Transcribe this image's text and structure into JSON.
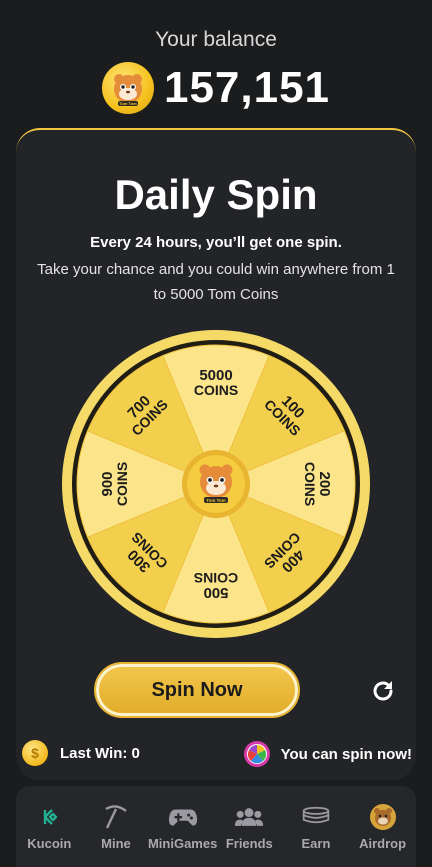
{
  "header": {
    "balance_label": "Your balance",
    "balance_value": "157,151",
    "avatar_caption": "Tom Tom"
  },
  "spin": {
    "title": "Daily Spin",
    "subtitle": "Every 24 hours, you’ll get one spin.",
    "description": "Take your chance and you could win anywhere from 1 to 5000 Tom Coins",
    "center_caption": "Tom Tom",
    "segments": [
      {
        "amount": "5000",
        "unit": "COINS"
      },
      {
        "amount": "100",
        "unit": "COINS"
      },
      {
        "amount": "200",
        "unit": "COINS"
      },
      {
        "amount": "400",
        "unit": "COINS"
      },
      {
        "amount": "500",
        "unit": "COINS"
      },
      {
        "amount": "300",
        "unit": "COINS"
      },
      {
        "amount": "900",
        "unit": "COINS"
      },
      {
        "amount": "700",
        "unit": "COINS"
      }
    ],
    "button_label": "Spin Now",
    "last_win": "Last Win: 0",
    "status": "You can spin now!"
  },
  "nav": {
    "items": [
      {
        "label": "Kucoin",
        "icon": "kucoin-icon"
      },
      {
        "label": "Mine",
        "icon": "pickaxe-icon"
      },
      {
        "label": "MiniGames",
        "icon": "gamepad-icon"
      },
      {
        "label": "Friends",
        "icon": "friends-icon"
      },
      {
        "label": "Earn",
        "icon": "coins-stack-icon"
      },
      {
        "label": "Airdrop",
        "icon": "airdrop-avatar-icon"
      }
    ]
  },
  "colors": {
    "background": "#1b1c1e",
    "panel": "#232427",
    "accent": "#f0c542",
    "wheel_light": "#fbe48a",
    "wheel_dark": "#f3cf4e"
  }
}
